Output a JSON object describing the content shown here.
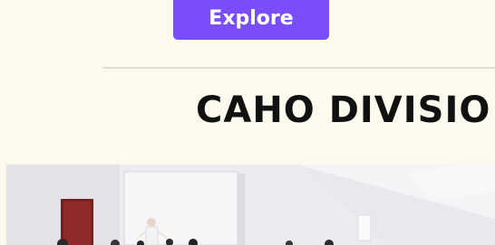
{
  "hero": {
    "button_label": "Explore"
  },
  "division": {
    "title": "CAHO DIVISIO",
    "photo_alt": "classroom-training-session"
  },
  "colors": {
    "page_background": "#fcf9ed",
    "accent": "#7a4dfb",
    "divider": "#e2ddd3",
    "title_text": "#111111"
  }
}
